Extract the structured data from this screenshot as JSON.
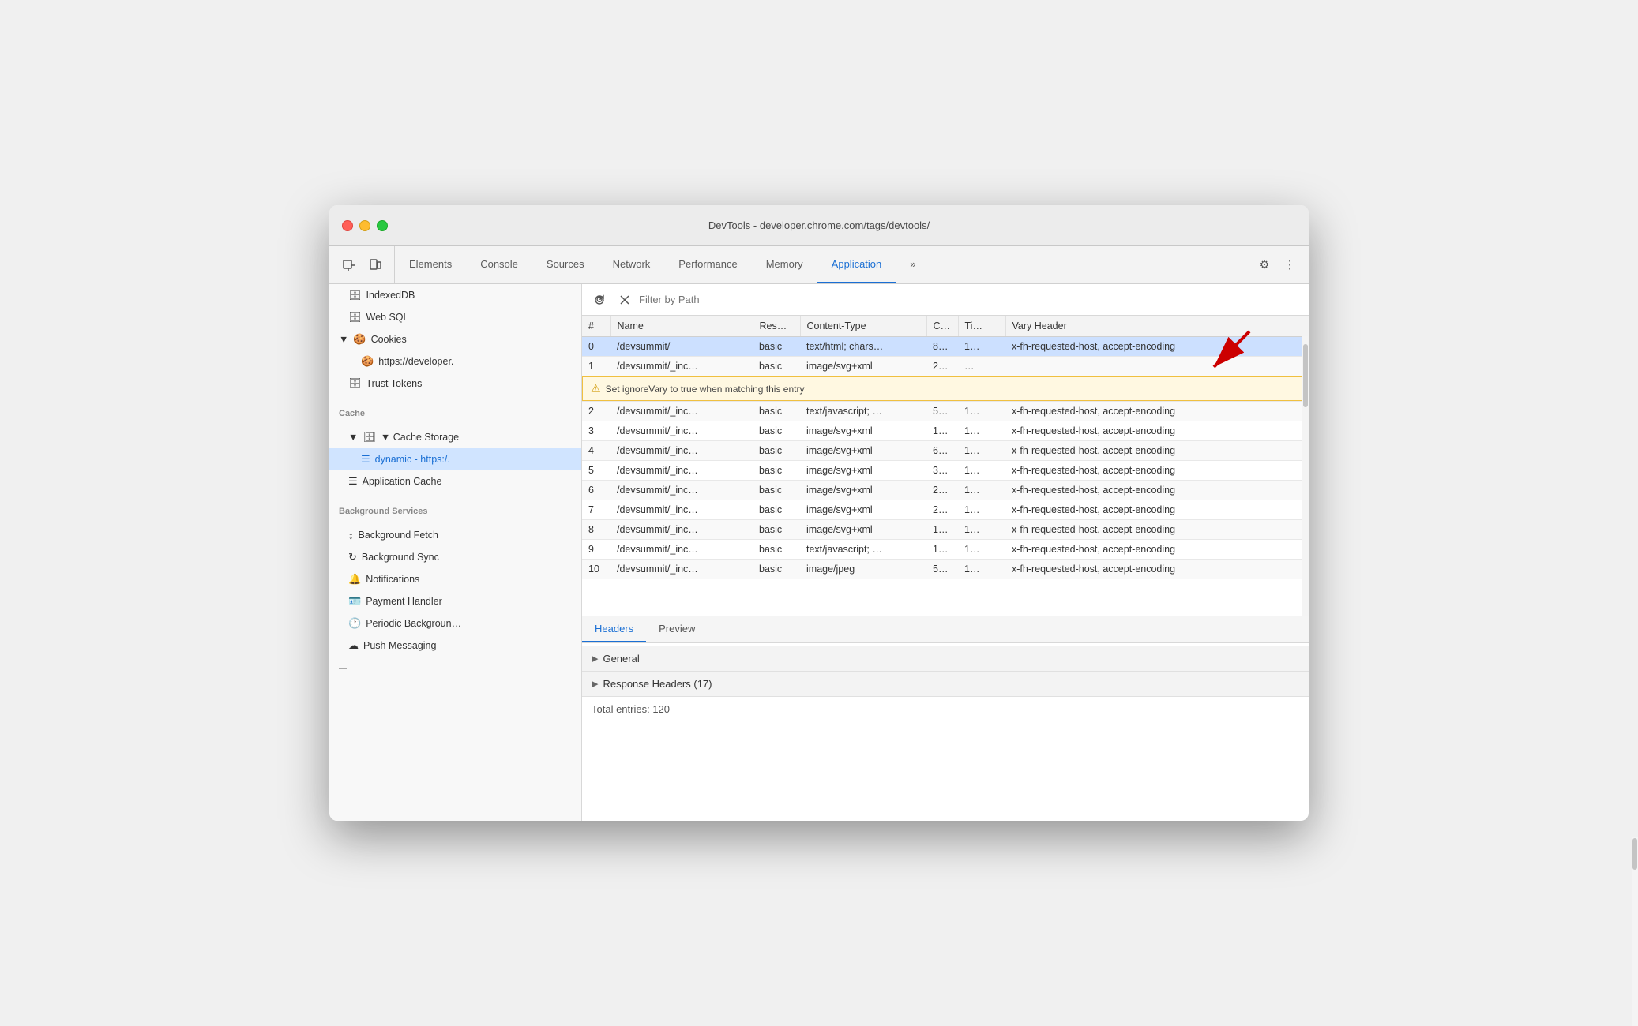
{
  "window": {
    "title": "DevTools - developer.chrome.com/tags/devtools/"
  },
  "tabs": [
    {
      "id": "elements",
      "label": "Elements",
      "active": false
    },
    {
      "id": "console",
      "label": "Console",
      "active": false
    },
    {
      "id": "sources",
      "label": "Sources",
      "active": false
    },
    {
      "id": "network",
      "label": "Network",
      "active": false
    },
    {
      "id": "performance",
      "label": "Performance",
      "active": false
    },
    {
      "id": "memory",
      "label": "Memory",
      "active": false
    },
    {
      "id": "application",
      "label": "Application",
      "active": true
    }
  ],
  "more_tabs_icon": "»",
  "settings_icon": "⚙",
  "more_icon": "⋮",
  "sidebar": {
    "items": [
      {
        "id": "indexeddb",
        "label": "IndexedDB",
        "icon": "🗄",
        "indent": 1,
        "selected": false
      },
      {
        "id": "websql",
        "label": "Web SQL",
        "icon": "🗄",
        "indent": 1,
        "selected": false
      },
      {
        "id": "cookies-header",
        "label": "▼ 🍪 Cookies",
        "indent": 0,
        "selected": false,
        "header": false
      },
      {
        "id": "cookies-item",
        "label": "https://developer.",
        "icon": "🍪",
        "indent": 2,
        "selected": false
      },
      {
        "id": "trust-tokens",
        "label": "Trust Tokens",
        "icon": "🗄",
        "indent": 1,
        "selected": false
      },
      {
        "id": "cache-section",
        "label": "Cache",
        "indent": 0,
        "selected": false,
        "section": true
      },
      {
        "id": "cache-storage",
        "label": "▼ Cache Storage",
        "icon": "🗄",
        "indent": 1,
        "selected": false
      },
      {
        "id": "dynamic-cache",
        "label": "dynamic - https:/.",
        "icon": "☰",
        "indent": 2,
        "selected": true
      },
      {
        "id": "application-cache",
        "label": "Application Cache",
        "icon": "☰",
        "indent": 1,
        "selected": false
      },
      {
        "id": "bg-services-section",
        "label": "Background Services",
        "indent": 0,
        "selected": false,
        "section": true
      },
      {
        "id": "background-fetch",
        "label": "Background Fetch",
        "icon": "↕",
        "indent": 1,
        "selected": false
      },
      {
        "id": "background-sync",
        "label": "Background Sync",
        "icon": "↻",
        "indent": 1,
        "selected": false
      },
      {
        "id": "notifications",
        "label": "Notifications",
        "icon": "🔔",
        "indent": 1,
        "selected": false
      },
      {
        "id": "payment-handler",
        "label": "Payment Handler",
        "icon": "🪪",
        "indent": 1,
        "selected": false
      },
      {
        "id": "periodic-bg",
        "label": "Periodic Backgroun…",
        "icon": "🕐",
        "indent": 1,
        "selected": false
      },
      {
        "id": "push-messaging",
        "label": "Push Messaging",
        "icon": "☁",
        "indent": 1,
        "selected": false
      }
    ]
  },
  "filter": {
    "placeholder": "Filter by Path"
  },
  "table": {
    "columns": [
      "#",
      "Name",
      "Res…",
      "Content-Type",
      "C…",
      "Ti…",
      "Vary Header"
    ],
    "rows": [
      {
        "num": "0",
        "name": "/devsummit/",
        "res": "basic",
        "ct": "text/html; chars…",
        "c": "8…",
        "ti": "1…",
        "vary": "x-fh-requested-host, accept-encoding",
        "selected": true
      },
      {
        "num": "1",
        "name": "/devsummit/_inc…",
        "res": "basic",
        "ct": "image/svg+xml",
        "c": "2…",
        "ti": "…",
        "vary": "",
        "tooltip": true
      },
      {
        "num": "2",
        "name": "/devsummit/_inc…",
        "res": "basic",
        "ct": "text/javascript; …",
        "c": "5…",
        "ti": "1…",
        "vary": "x-fh-requested-host, accept-encoding",
        "selected": false
      },
      {
        "num": "3",
        "name": "/devsummit/_inc…",
        "res": "basic",
        "ct": "image/svg+xml",
        "c": "1…",
        "ti": "1…",
        "vary": "x-fh-requested-host, accept-encoding",
        "selected": false
      },
      {
        "num": "4",
        "name": "/devsummit/_inc…",
        "res": "basic",
        "ct": "image/svg+xml",
        "c": "6…",
        "ti": "1…",
        "vary": "x-fh-requested-host, accept-encoding",
        "selected": false
      },
      {
        "num": "5",
        "name": "/devsummit/_inc…",
        "res": "basic",
        "ct": "image/svg+xml",
        "c": "3…",
        "ti": "1…",
        "vary": "x-fh-requested-host, accept-encoding",
        "selected": false
      },
      {
        "num": "6",
        "name": "/devsummit/_inc…",
        "res": "basic",
        "ct": "image/svg+xml",
        "c": "2…",
        "ti": "1…",
        "vary": "x-fh-requested-host, accept-encoding",
        "selected": false
      },
      {
        "num": "7",
        "name": "/devsummit/_inc…",
        "res": "basic",
        "ct": "image/svg+xml",
        "c": "2…",
        "ti": "1…",
        "vary": "x-fh-requested-host, accept-encoding",
        "selected": false
      },
      {
        "num": "8",
        "name": "/devsummit/_inc…",
        "res": "basic",
        "ct": "image/svg+xml",
        "c": "1…",
        "ti": "1…",
        "vary": "x-fh-requested-host, accept-encoding",
        "selected": false
      },
      {
        "num": "9",
        "name": "/devsummit/_inc…",
        "res": "basic",
        "ct": "text/javascript; …",
        "c": "1…",
        "ti": "1…",
        "vary": "x-fh-requested-host, accept-encoding",
        "selected": false
      },
      {
        "num": "10",
        "name": "/devsummit/_inc…",
        "res": "basic",
        "ct": "image/jpeg",
        "c": "5…",
        "ti": "1…",
        "vary": "x-fh-requested-host, accept-encoding",
        "selected": false
      }
    ],
    "tooltip_text": "Set ignoreVary to true when matching this entry"
  },
  "bottom_pane": {
    "tabs": [
      {
        "id": "headers",
        "label": "Headers",
        "active": true
      },
      {
        "id": "preview",
        "label": "Preview",
        "active": false
      }
    ],
    "sections": [
      {
        "id": "general",
        "label": "General",
        "expanded": false
      },
      {
        "id": "response-headers",
        "label": "Response Headers (17)",
        "expanded": false
      }
    ],
    "total_entries": "Total entries: 120"
  },
  "colors": {
    "accent": "#1a6fd4",
    "selected_row": "#cce0ff",
    "tooltip_bg": "#fff8e1",
    "header_bg": "#f3f3f3"
  }
}
